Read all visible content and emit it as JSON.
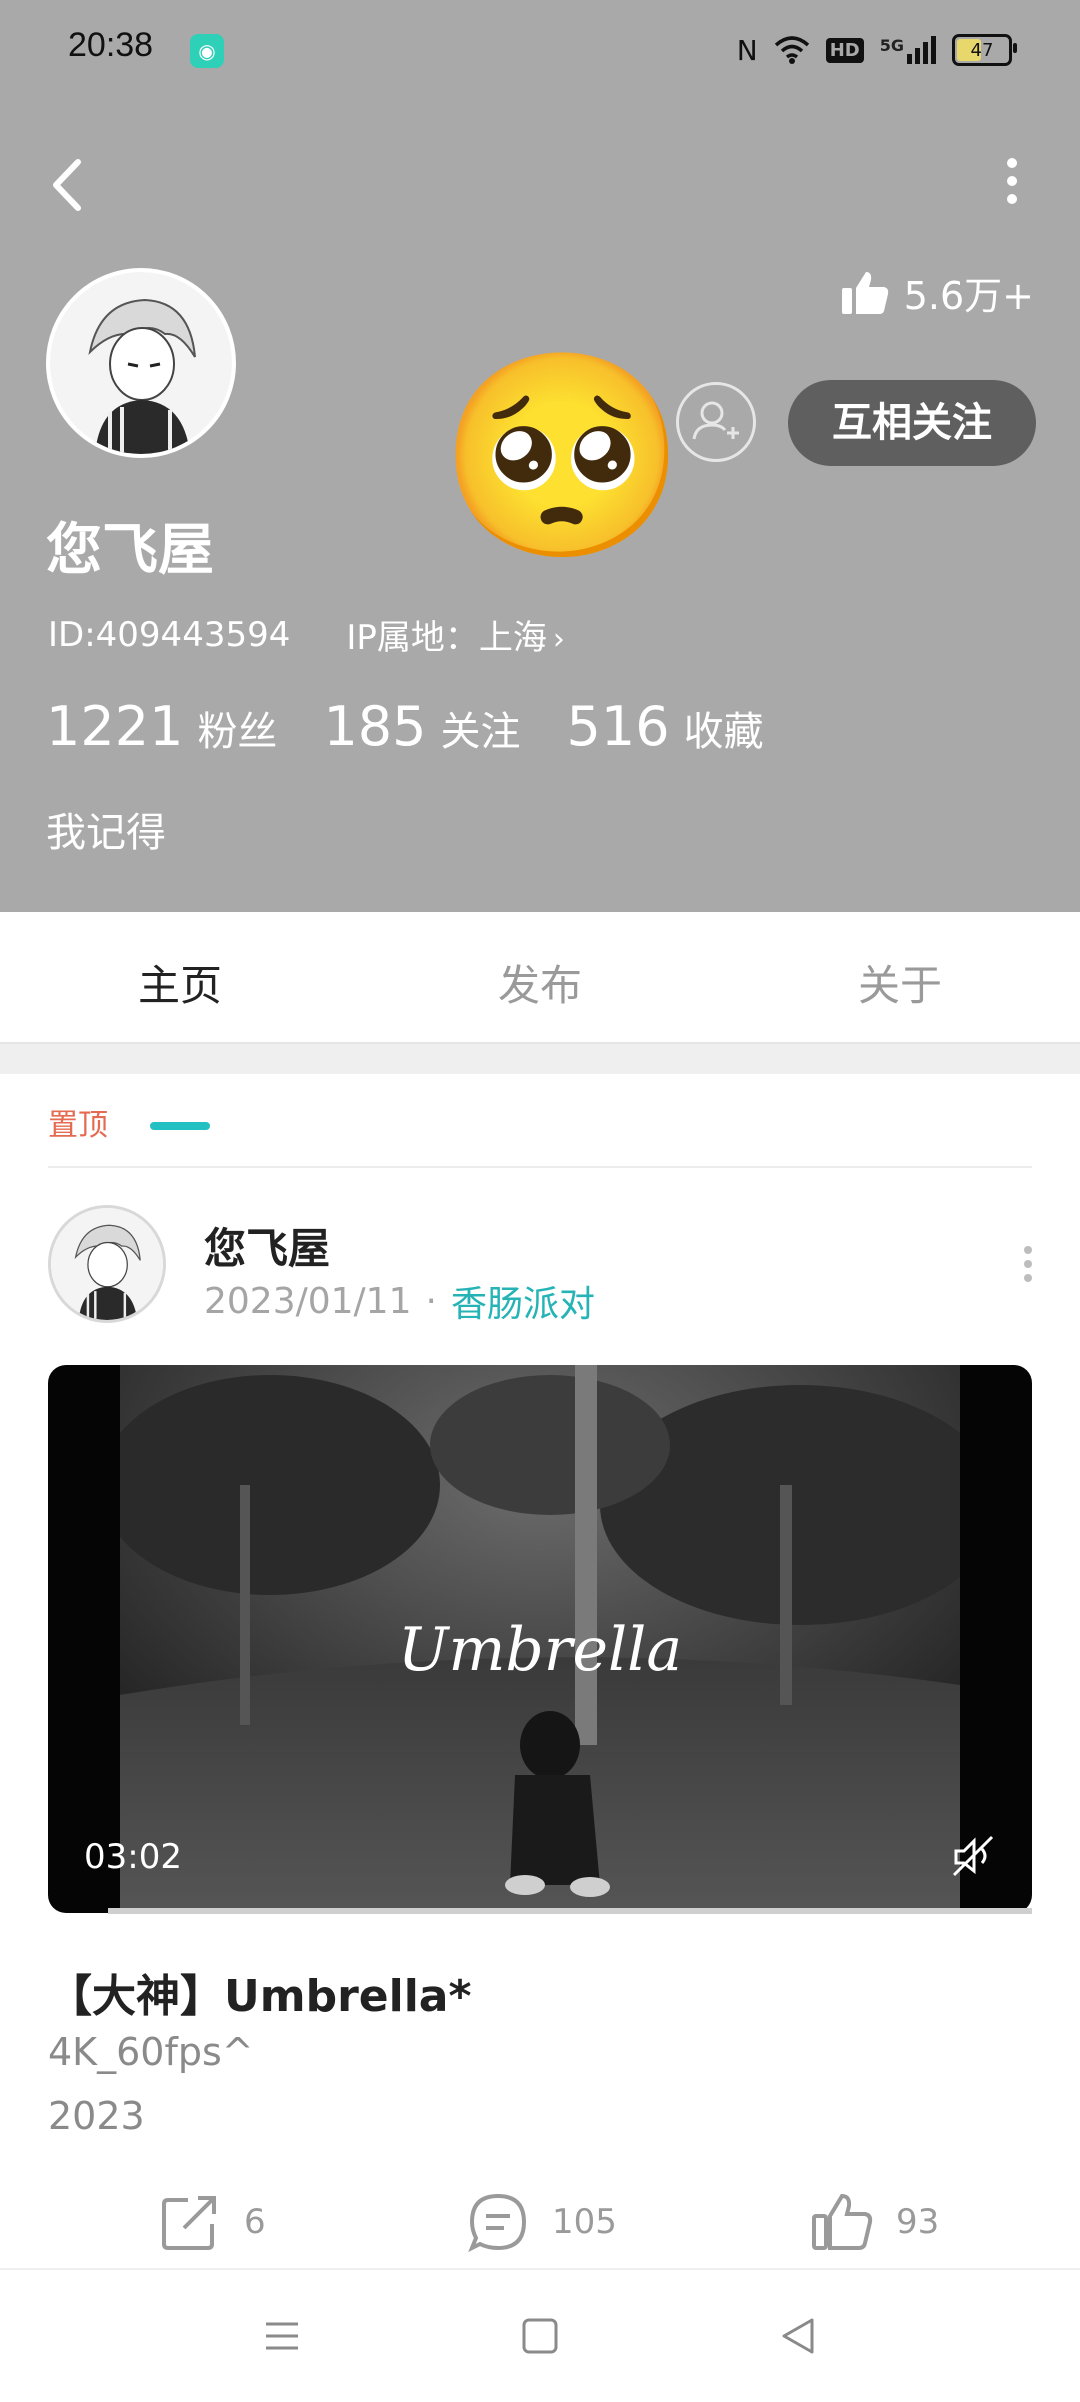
{
  "status_bar": {
    "time": "20:38",
    "hd_label": "HD",
    "network_label": "5G",
    "battery_level": "47",
    "icons": [
      "nfc-icon",
      "wifi-icon",
      "hd-icon",
      "signal-5g-icon",
      "battery-icon"
    ]
  },
  "profile": {
    "likes_total": "5.6万+",
    "name": "您飞屋",
    "id_text": "ID:409443594",
    "ip_location": "IP属地：上海",
    "stats": [
      {
        "value": "1221",
        "label": "粉丝"
      },
      {
        "value": "185",
        "label": "关注"
      },
      {
        "value": "516",
        "label": "收藏"
      }
    ],
    "bio": "我记得",
    "mutual_follow_label": "互相关注",
    "emoji": "🥺"
  },
  "tabs": [
    {
      "label": "主页",
      "active": true
    },
    {
      "label": "发布",
      "active": false
    },
    {
      "label": "关于",
      "active": false
    }
  ],
  "feed": {
    "pinned_label": "置顶",
    "post": {
      "author": "您飞屋",
      "date": "2023/01/11",
      "dot": "·",
      "topic": "香肠派对",
      "video_title": "Umbrella",
      "duration": "03:02",
      "title": "【大神】Umbrella*",
      "lines": [
        "4K_60fps^",
        "2023"
      ],
      "shares": "6",
      "comments": "105",
      "likes": "93"
    }
  },
  "colors": {
    "header_bg": "#a9a9a9",
    "accent": "#22c0c2",
    "pinned": "#e46b52",
    "button_dark": "#5f5f5f"
  }
}
